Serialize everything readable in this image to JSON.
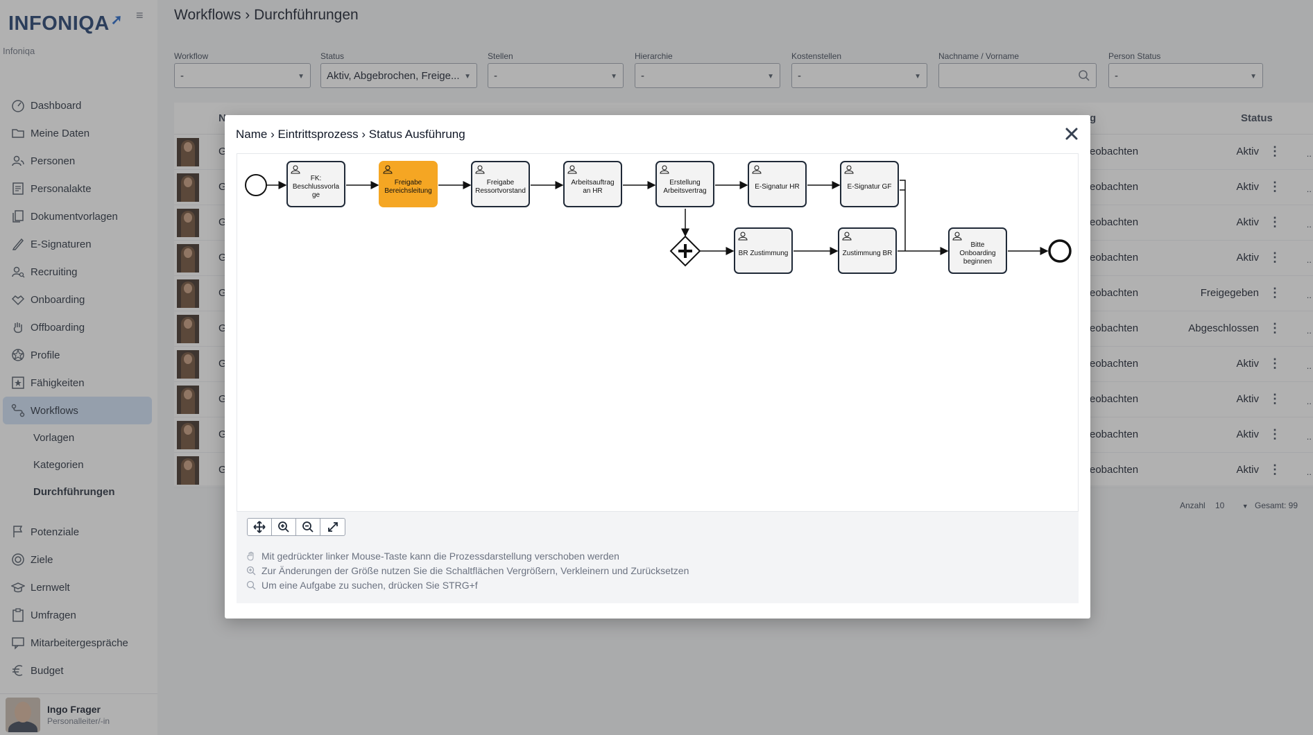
{
  "sidebar": {
    "logo": "INFONIQA",
    "org_name": "Infoniqa",
    "items": [
      {
        "label": "Dashboard",
        "icon": "dashboard-icon"
      },
      {
        "label": "Meine Daten",
        "icon": "folder-icon"
      },
      {
        "label": "Personen",
        "icon": "people-icon"
      },
      {
        "label": "Personalakte",
        "icon": "file-icon"
      },
      {
        "label": "Dokumentvorlagen",
        "icon": "documents-icon"
      },
      {
        "label": "E-Signaturen",
        "icon": "pen-icon"
      },
      {
        "label": "Recruiting",
        "icon": "recruiting-icon"
      },
      {
        "label": "Onboarding",
        "icon": "handshake-icon"
      },
      {
        "label": "Offboarding",
        "icon": "hand-icon"
      },
      {
        "label": "Profile",
        "icon": "profile-icon"
      },
      {
        "label": "Fähigkeiten",
        "icon": "star-icon"
      },
      {
        "label": "Workflows",
        "icon": "workflow-icon"
      }
    ],
    "sub_items": [
      "Vorlagen",
      "Kategorien",
      "Durchführungen"
    ],
    "items_lower": [
      {
        "label": "Potenziale",
        "icon": "flag-icon"
      },
      {
        "label": "Ziele",
        "icon": "target-icon"
      },
      {
        "label": "Lernwelt",
        "icon": "graduation-icon"
      },
      {
        "label": "Umfragen",
        "icon": "clipboard-icon"
      },
      {
        "label": "Mitarbeitergespräche",
        "icon": "chat-icon"
      },
      {
        "label": "Budget",
        "icon": "euro-icon"
      }
    ],
    "user": {
      "name": "Ingo Frager",
      "role": "Personalleiter/-in"
    }
  },
  "header": {
    "title": "Workflows › Durchführungen"
  },
  "filters": [
    {
      "label": "Workflow",
      "value": "-"
    },
    {
      "label": "Status",
      "value": "Aktiv, Abgebrochen, Freige..."
    },
    {
      "label": "Stellen",
      "value": "-"
    },
    {
      "label": "Hierarchie",
      "value": "-"
    },
    {
      "label": "Kostenstellen",
      "value": "-"
    },
    {
      "label": "Nachname / Vorname",
      "value": ""
    },
    {
      "label": "Person Status",
      "value": "-"
    }
  ],
  "table": {
    "header_name": "N",
    "header_observe": "g",
    "header_status": "Status",
    "rows": [
      {
        "name": "G",
        "observe": "eobachten",
        "status": "Aktiv"
      },
      {
        "name": "G",
        "observe": "eobachten",
        "status": "Aktiv"
      },
      {
        "name": "G",
        "observe": "eobachten",
        "status": "Aktiv"
      },
      {
        "name": "G",
        "observe": "eobachten",
        "status": "Aktiv"
      },
      {
        "name": "G",
        "observe": "eobachten",
        "status": "Freigegeben"
      },
      {
        "name": "G",
        "observe": "eobachten",
        "status": "Abgeschlossen"
      },
      {
        "name": "G",
        "observe": "eobachten",
        "status": "Aktiv"
      },
      {
        "name": "G",
        "observe": "eobachten",
        "status": "Aktiv"
      },
      {
        "name": "G",
        "observe": "eobachten",
        "status": "Aktiv"
      },
      {
        "name": "G",
        "observe": "eobachten",
        "status": "Aktiv"
      }
    ],
    "kebab": "⋮",
    "more": "..",
    "pager_label": "Anzahl",
    "pager_value": "10",
    "total": "Gesamt: 99"
  },
  "modal": {
    "title": "Name › Eintrittsprozess › Status Ausführung",
    "tasks": [
      {
        "label": "FK: Beschlussvorla ge",
        "active": false
      },
      {
        "label": "Freigabe Bereichsleitung",
        "active": true
      },
      {
        "label": "Freigabe Ressortvorstand",
        "active": false
      },
      {
        "label": "Arbeitsauftrag an HR",
        "active": false
      },
      {
        "label": "Erstellung Arbeitsvertrag",
        "active": false
      },
      {
        "label": "E-Signatur HR",
        "active": false
      },
      {
        "label": "E-Signatur GF",
        "active": false
      },
      {
        "label": "BR Zustimmung",
        "active": false
      },
      {
        "label": "Zustimmung BR",
        "active": false
      },
      {
        "label": "Bitte Onboarding beginnen",
        "active": false
      }
    ],
    "active_color": "#f5a623",
    "hints": [
      "Mit gedrückter linker Mouse-Taste kann die Prozessdarstellung verschoben werden",
      "Zur Änderungen der Größe nutzen Sie die Schaltflächen Vergrößern, Verkleinern und Zurücksetzen",
      "Um eine Aufgabe zu suchen, drücken Sie STRG+f"
    ]
  }
}
